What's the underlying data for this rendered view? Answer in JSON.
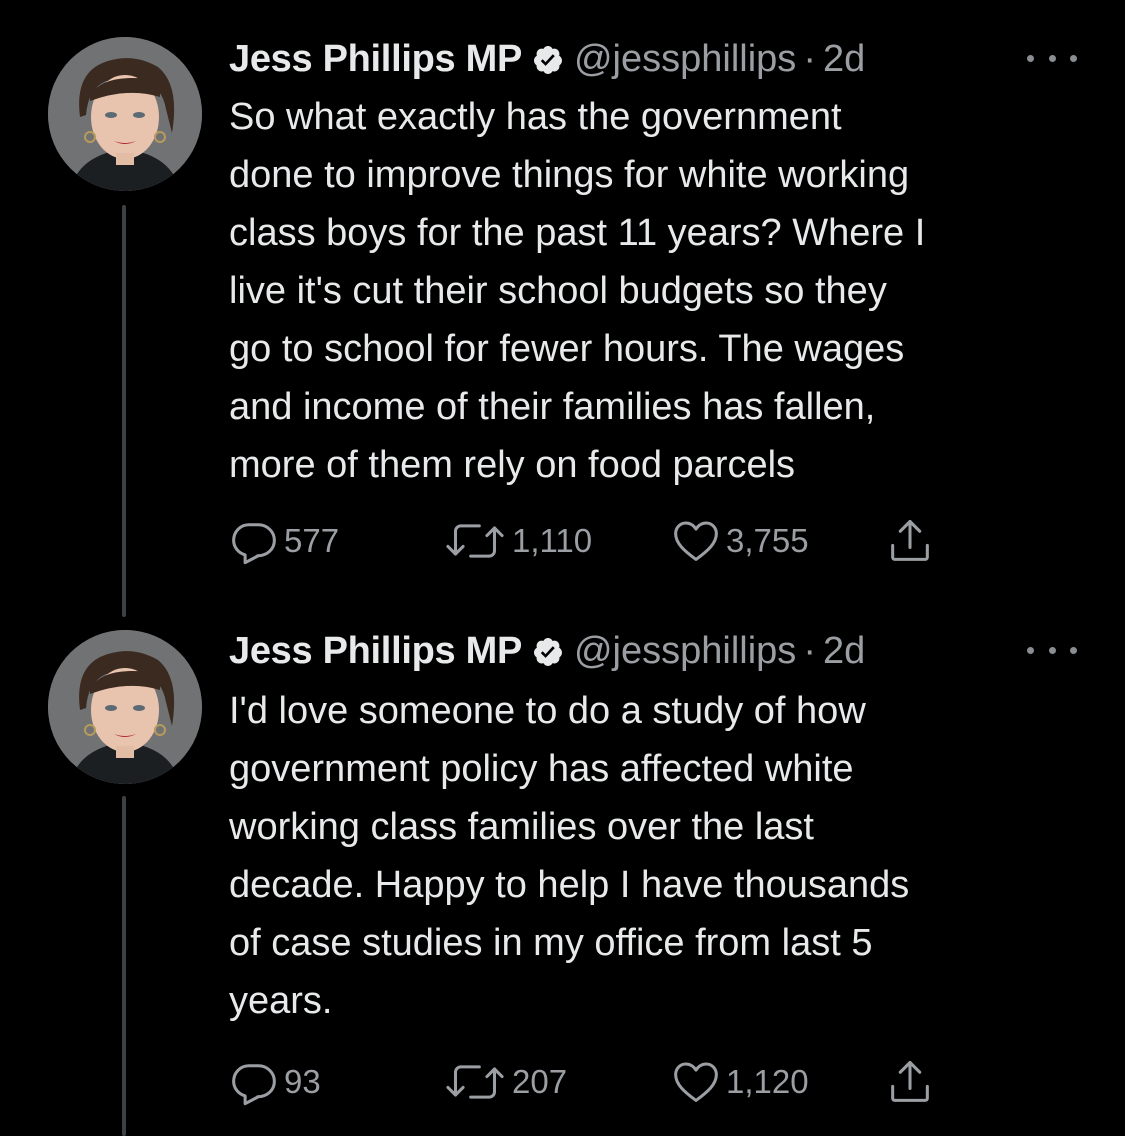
{
  "tweets": [
    {
      "author": {
        "display_name": "Jess Phillips MP",
        "handle": "@jessphillips",
        "verified": true
      },
      "separator": "·",
      "time": "2d",
      "text": "So what exactly has the government\ndone to improve things for white working\nclass boys for the past 11 years? Where I\nlive it's cut their school budgets so they\ngo to school for fewer hours. The wages\nand income of their families has fallen,\nmore of them rely on food parcels",
      "stats": {
        "replies": "577",
        "retweets": "1,110",
        "likes": "3,755"
      }
    },
    {
      "author": {
        "display_name": "Jess Phillips MP",
        "handle": "@jessphillips",
        "verified": true
      },
      "separator": "·",
      "time": "2d",
      "text": "I'd love someone to do a study of how\ngovernment policy has affected white\nworking class families over the last\ndecade. Happy to help I have thousands\nof case studies in my office from last 5\nyears.",
      "stats": {
        "replies": "93",
        "retweets": "207",
        "likes": "1,120"
      }
    }
  ],
  "icons": {
    "avatar": "profile-photo",
    "verified": "verified-badge-icon",
    "more": "more-options-icon",
    "reply": "reply-icon",
    "retweet": "retweet-icon",
    "like": "heart-icon",
    "share": "share-icon"
  },
  "colors": {
    "background": "#000000",
    "primary_text": "#e7e9ea",
    "secondary_text": "#9b9fa3",
    "thread_line": "#3d4144"
  }
}
